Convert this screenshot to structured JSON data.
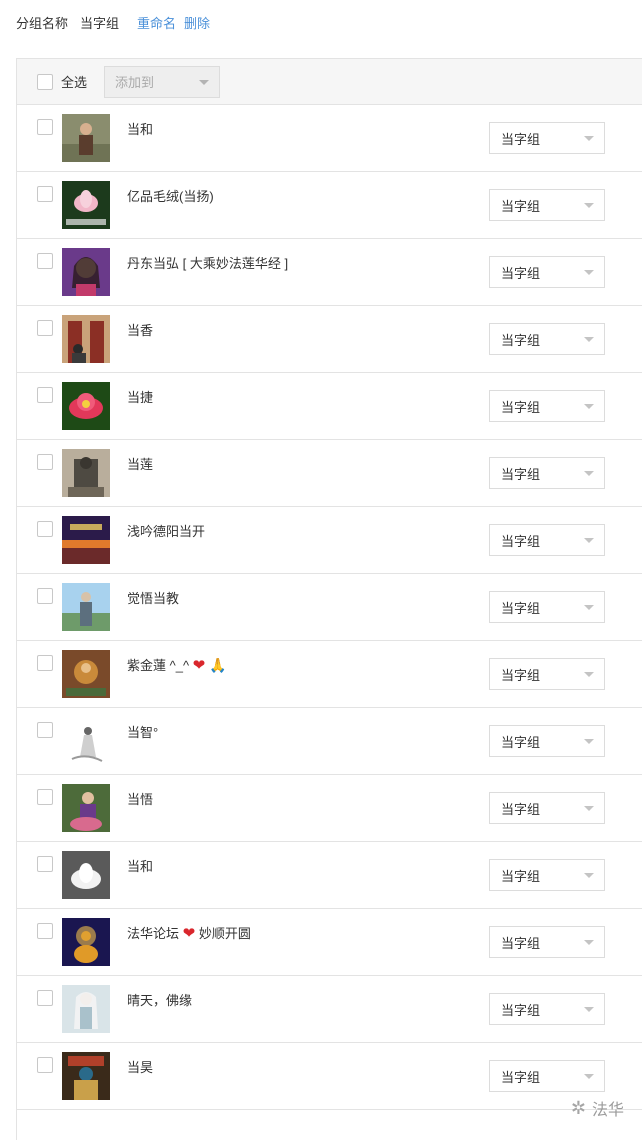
{
  "header": {
    "group_name_label": "分组名称",
    "group_name_value": "当字组",
    "rename_label": "重命名",
    "delete_label": "删除"
  },
  "toolbar": {
    "select_all_label": "全选",
    "add_to_placeholder": "添加到"
  },
  "members": [
    {
      "name": "当和",
      "group": "当字组",
      "avatar": "portrait-outdoor"
    },
    {
      "name": "亿品毛绒(当扬)",
      "group": "当字组",
      "avatar": "lotus-pink-text"
    },
    {
      "name": "丹东当弘 [ 大乘妙法莲华经 ]",
      "group": "当字组",
      "avatar": "woman-portrait"
    },
    {
      "name": "当香",
      "group": "当字组",
      "avatar": "temple-gate"
    },
    {
      "name": "当捷",
      "group": "当字组",
      "avatar": "lotus-red"
    },
    {
      "name": "当莲",
      "group": "当字组",
      "avatar": "buddha-statue-dark"
    },
    {
      "name": "浅吟德阳当开",
      "group": "当字组",
      "avatar": "sunset-banner"
    },
    {
      "name": "觉悟当教",
      "group": "当字组",
      "avatar": "figure-blue-sky"
    },
    {
      "name": "紫金蓮 ^_^ ",
      "group": "当字组",
      "avatar": "thangka"
    },
    {
      "name": "当智°",
      "group": "当字组",
      "avatar": "ink-figure"
    },
    {
      "name": "当悟",
      "group": "当字组",
      "avatar": "woman-garden"
    },
    {
      "name": "当和",
      "group": "当字组",
      "avatar": "lotus-white"
    },
    {
      "name": "法华论坛 ",
      "suffix": " 妙顺开圆",
      "group": "当字组",
      "avatar": "golden-buddha"
    },
    {
      "name": "晴天，佛缘",
      "group": "当字组",
      "avatar": "guanyin"
    },
    {
      "name": "当昊",
      "group": "当字组",
      "avatar": "guardian-deity"
    }
  ],
  "emoji": {
    "heart": "❤",
    "pray": "🙏"
  },
  "watermark": {
    "text": "法华",
    "icon": "wechat-icon"
  }
}
